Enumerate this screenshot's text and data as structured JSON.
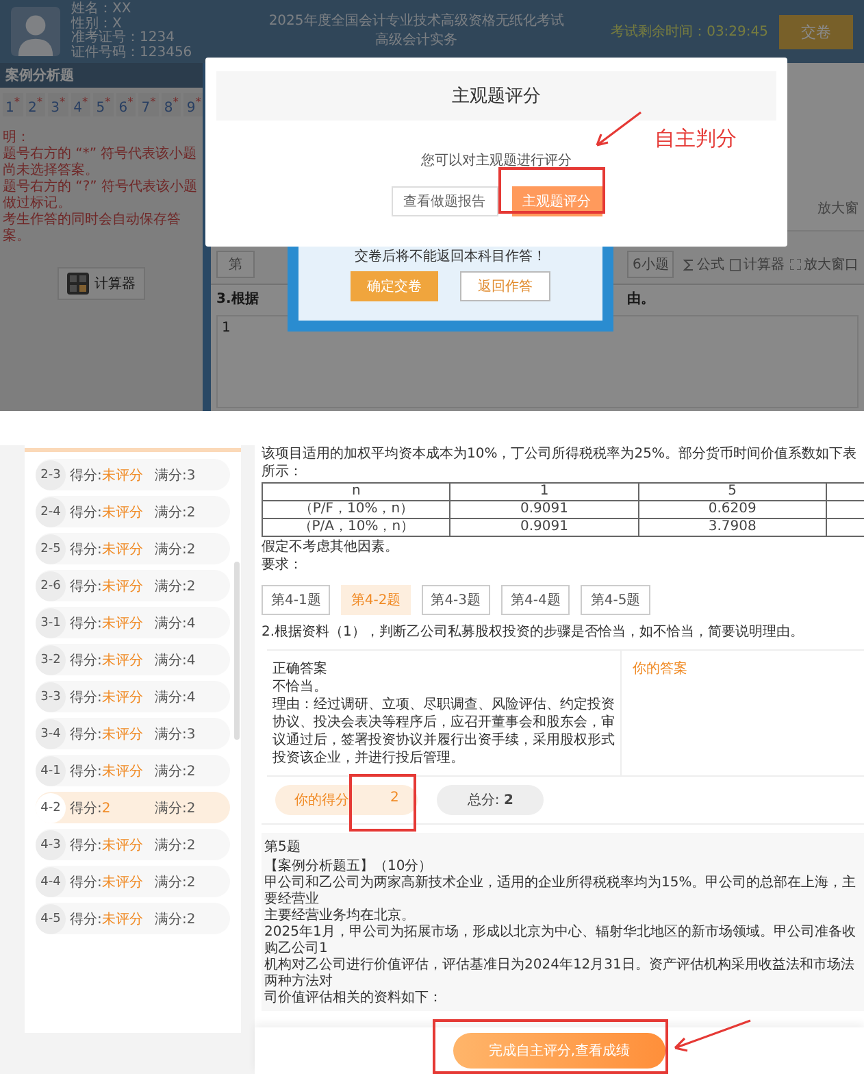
{
  "exam_screen": {
    "candidate": [
      "姓名：XX",
      "性别：X",
      "准考证号：1234",
      "证件号码：123456"
    ],
    "exam_title": [
      "2025年度全国会计专业技术高级资格无纸化考试",
      "高级会计实务"
    ],
    "timer": "考试剩余时间：03:29:45",
    "submit_button": "交卷",
    "section_title": "案例分析题",
    "question_numbers": [
      {
        "label": "1",
        "mark": "*"
      },
      {
        "label": "2",
        "mark": "*"
      },
      {
        "label": "3",
        "mark": "*"
      },
      {
        "label": "4",
        "mark": "*"
      },
      {
        "label": "5",
        "mark": "*"
      },
      {
        "label": "6",
        "mark": "*"
      },
      {
        "label": "7",
        "mark": "*"
      },
      {
        "label": "8",
        "mark": "*"
      },
      {
        "label": "9",
        "mark": "*"
      }
    ],
    "notes": [
      "明：",
      "题号右方的 “*” 符号代表该小题尚未选择答案。",
      "题号右方的 “?” 符号代表该小题做过标记。",
      "考生作答的同时会自动保存答案。"
    ],
    "calculator_button": "计算器",
    "zoom_top": "放大窗",
    "question_tab": "第",
    "subquestion_tab": "6小题",
    "tools": [
      {
        "label": "公式",
        "kind": "formula"
      },
      {
        "label": "计算器",
        "kind": "calculator"
      },
      {
        "label": "放大窗口",
        "kind": "zoom"
      }
    ],
    "question_start": "3.根据",
    "question_end": "由。",
    "answer_line": "1",
    "confirm_dialog": {
      "message": "交卷后将不能返回本科目作答！",
      "buttons": [
        {
          "label": "确定交卷",
          "kind": "primary"
        },
        {
          "label": "返回作答",
          "kind": "secondary"
        }
      ]
    },
    "grading_modal": {
      "title": "主观题评分",
      "message": "您可以对主观题进行评分",
      "buttons": [
        {
          "label": "查看做题报告",
          "kind": "secondary"
        },
        {
          "label": "主观题评分",
          "kind": "primary"
        }
      ]
    },
    "annotation": "自主判分"
  },
  "review_screen": {
    "sidebar": [
      {
        "id": "2-3",
        "score_label": "得分:",
        "score": "未评分",
        "full": "满分:3",
        "selected": false
      },
      {
        "id": "2-4",
        "score_label": "得分:",
        "score": "未评分",
        "full": "满分:2",
        "selected": false
      },
      {
        "id": "2-5",
        "score_label": "得分:",
        "score": "未评分",
        "full": "满分:2",
        "selected": false
      },
      {
        "id": "2-6",
        "score_label": "得分:",
        "score": "未评分",
        "full": "满分:2",
        "selected": false
      },
      {
        "id": "3-1",
        "score_label": "得分:",
        "score": "未评分",
        "full": "满分:4",
        "selected": false
      },
      {
        "id": "3-2",
        "score_label": "得分:",
        "score": "未评分",
        "full": "满分:4",
        "selected": false
      },
      {
        "id": "3-3",
        "score_label": "得分:",
        "score": "未评分",
        "full": "满分:4",
        "selected": false
      },
      {
        "id": "3-4",
        "score_label": "得分:",
        "score": "未评分",
        "full": "满分:3",
        "selected": false
      },
      {
        "id": "4-1",
        "score_label": "得分:",
        "score": "未评分",
        "full": "满分:2",
        "selected": false
      },
      {
        "id": "4-2",
        "score_label": "得分:",
        "score": "2",
        "full": "满分:2",
        "selected": true
      },
      {
        "id": "4-3",
        "score_label": "得分:",
        "score": "未评分",
        "full": "满分:2",
        "selected": false
      },
      {
        "id": "4-4",
        "score_label": "得分:",
        "score": "未评分",
        "full": "满分:2",
        "selected": false
      },
      {
        "id": "4-5",
        "score_label": "得分:",
        "score": "未评分",
        "full": "满分:2",
        "selected": false
      }
    ],
    "intro": "该项目适用的加权平均资本成本为10%，丁公司所得税税率为25%。部分货币时间价值系数如下表所示：",
    "table": [
      [
        "n",
        "1",
        "5"
      ],
      [
        "（P/F，10%，n）",
        "0.9091",
        "0.6209"
      ],
      [
        "（P/A，10%，n）",
        "0.9091",
        "3.7908"
      ]
    ],
    "notes": [
      "假定不考虑其他因素。",
      "要求："
    ],
    "subquestion_tabs": [
      {
        "label": "第4-1题",
        "selected": false
      },
      {
        "label": "第4-2题",
        "selected": true
      },
      {
        "label": "第4-3题",
        "selected": false
      },
      {
        "label": "第4-4题",
        "selected": false
      },
      {
        "label": "第4-5题",
        "selected": false
      }
    ],
    "question": "2.根据资料（1），判断乙公司私募股权投资的步骤是否恰当，如不恰当，简要说明理由。",
    "correct_answer": {
      "heading": "正确答案",
      "lines": [
        "不恰当。",
        "理由：经过调研、立项、尽职调查、风险评估、约定投资协议、投决会表决等程序后，应召开董事会和股东会，审议通过后，签署投资协议并履行出资手续，采用股权形式投资该企业，并进行投后管理。"
      ]
    },
    "your_answer": "你的答案",
    "your_score": {
      "label": "你的得分",
      "value": "2"
    },
    "total": {
      "label": "总分:",
      "value": "2"
    },
    "next_question": {
      "heading": "第5题",
      "lines": [
        "【案例分析题五】（10分）",
        "甲公司和乙公司为两家高新技术企业，适用的企业所得税税率均为15%。甲公司的总部在上海，主要经营业",
        "主要经营业务均在北京。",
        "2025年1月，甲公司为拓展市场，形成以北京为中心、辐射华北地区的新市场领域。甲公司准备收购乙公司1",
        "机构对乙公司进行价值评估，评估基准日为2024年12月31日。资产评估机构采用收益法和市场法两种方法对",
        "司价值评估相关的资料如下："
      ]
    },
    "finish_button": "完成自主评分,查看成绩"
  }
}
